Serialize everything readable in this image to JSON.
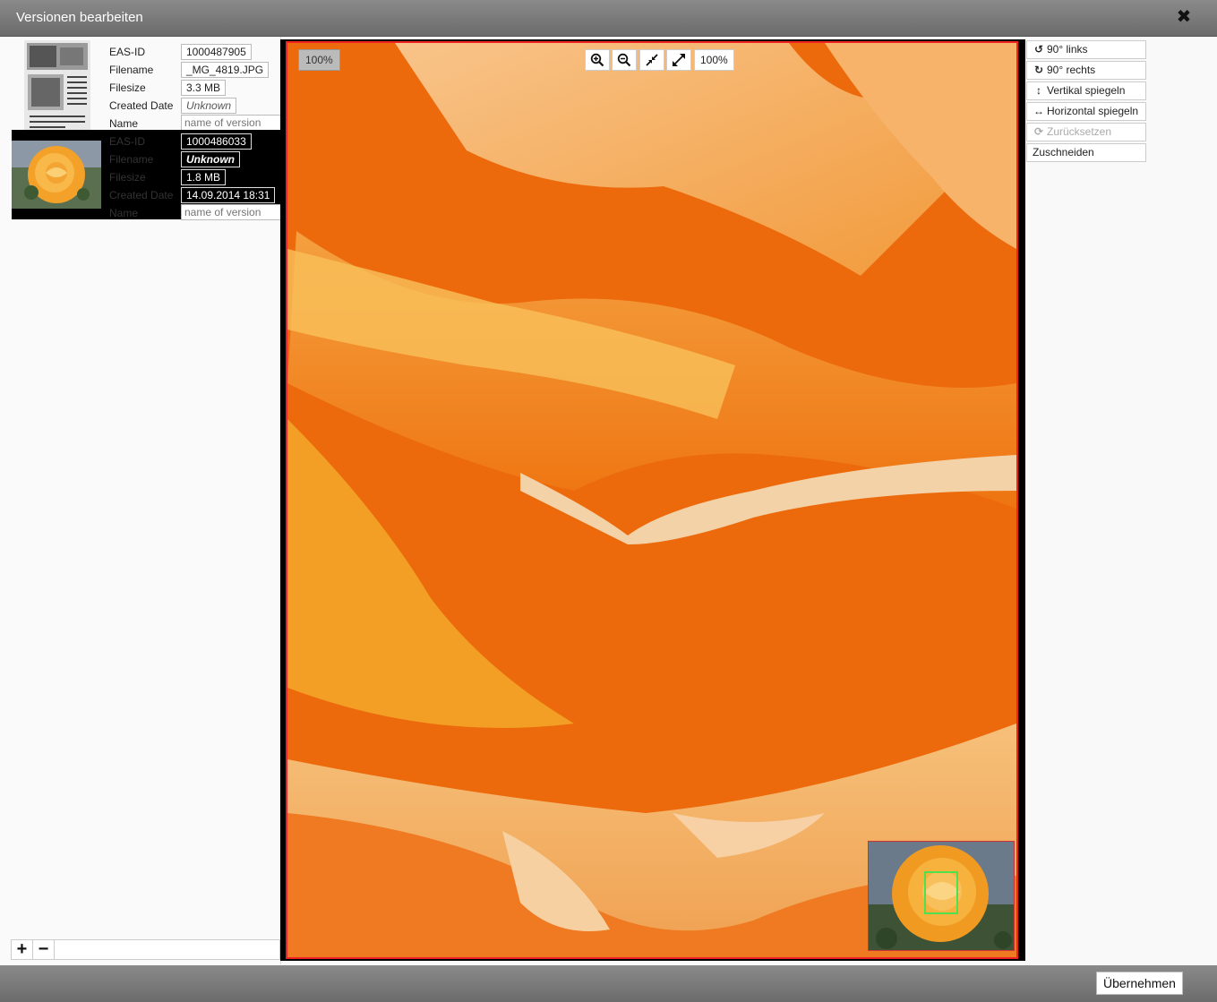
{
  "window": {
    "title": "Versionen bearbeiten",
    "close_icon": "close-icon"
  },
  "versions": [
    {
      "selected": false,
      "thumbnail": "document-scan-thumbnail",
      "labels": [
        "EAS-ID",
        "Filename",
        "Filesize",
        "Created Date",
        "Name"
      ],
      "eas_id": "1000487905",
      "filename": "_MG_4819.JPG",
      "filesize": "3.3 MB",
      "created_date": "Unknown",
      "name_placeholder": "name of version"
    },
    {
      "selected": true,
      "thumbnail": "rose-thumbnail",
      "labels": [
        "EAS-ID",
        "Filename",
        "Filesize",
        "Created Date",
        "Name"
      ],
      "eas_id": "1000486033",
      "filename": "Unknown",
      "filesize": "1.8 MB",
      "created_date": "14.09.2014 18:31",
      "name_placeholder": "name of version"
    }
  ],
  "left_footer": {
    "add_label": "+",
    "remove_label": "−"
  },
  "viewer": {
    "zoom_badge": "100%",
    "zoom_level": "100%",
    "toolbar_icons": [
      "zoom-in-icon",
      "zoom-out-icon",
      "shrink-icon",
      "expand-icon"
    ],
    "colors": {
      "frame": "#e22222",
      "minimap_viewport": "#4ee04e"
    }
  },
  "tools": [
    {
      "label": "90° links",
      "icon": "rotate-left-icon",
      "glyph": "↺",
      "enabled": true
    },
    {
      "label": "90° rechts",
      "icon": "rotate-right-icon",
      "glyph": "↻",
      "enabled": true
    },
    {
      "label": "Vertikal spiegeln",
      "icon": "flip-vertical-icon",
      "glyph": "↕",
      "enabled": true
    },
    {
      "label": "Horizontal spiegeln",
      "icon": "flip-horizontal-icon",
      "glyph": "↔",
      "enabled": true
    },
    {
      "label": "Zurücksetzen",
      "icon": "reset-icon",
      "glyph": "⟳",
      "enabled": false
    },
    {
      "label": "Zuschneiden",
      "icon": "",
      "glyph": "",
      "enabled": true
    }
  ],
  "footer": {
    "apply_label": "Übernehmen"
  }
}
